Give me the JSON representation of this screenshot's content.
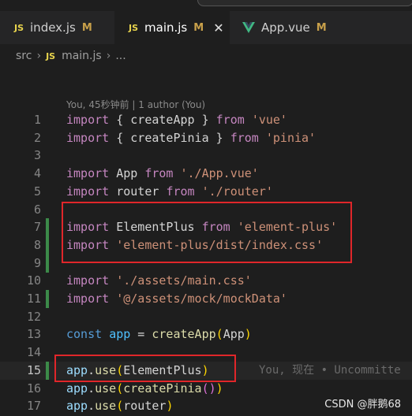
{
  "tabs": [
    {
      "label": "index.js",
      "icon": "js-icon",
      "status": "M",
      "active": false
    },
    {
      "label": "main.js",
      "icon": "js-icon",
      "status": "M",
      "active": true
    },
    {
      "label": "App.vue",
      "icon": "vue-icon",
      "status": "M",
      "active": false
    }
  ],
  "breadcrumb": {
    "folder": "src",
    "file": "main.js",
    "more": "..."
  },
  "blame_header": "You, 45秒钟前 | 1 author (You)",
  "inline_blame": "You, 现在 • Uncommitte",
  "watermark": "CSDN @胖鹅68",
  "lines": [
    {
      "n": "1",
      "tokens": [
        [
          "kw",
          "import"
        ],
        [
          "plain",
          " { createApp } "
        ],
        [
          "kw",
          "from"
        ],
        [
          "plain",
          " "
        ],
        [
          "str",
          "'vue'"
        ]
      ]
    },
    {
      "n": "2",
      "tokens": [
        [
          "kw",
          "import"
        ],
        [
          "plain",
          " { createPinia } "
        ],
        [
          "kw",
          "from"
        ],
        [
          "plain",
          " "
        ],
        [
          "str",
          "'pinia'"
        ]
      ]
    },
    {
      "n": "3",
      "tokens": []
    },
    {
      "n": "4",
      "tokens": [
        [
          "kw",
          "import"
        ],
        [
          "plain",
          " App "
        ],
        [
          "kw",
          "from"
        ],
        [
          "plain",
          " "
        ],
        [
          "str",
          "'./App.vue'"
        ]
      ]
    },
    {
      "n": "5",
      "tokens": [
        [
          "kw",
          "import"
        ],
        [
          "plain",
          " router "
        ],
        [
          "kw",
          "from"
        ],
        [
          "plain",
          " "
        ],
        [
          "str",
          "'./router'"
        ]
      ]
    },
    {
      "n": "6",
      "tokens": []
    },
    {
      "n": "7",
      "tokens": [
        [
          "kw",
          "import"
        ],
        [
          "plain",
          " ElementPlus "
        ],
        [
          "kw",
          "from"
        ],
        [
          "plain",
          " "
        ],
        [
          "str",
          "'element-plus'"
        ]
      ]
    },
    {
      "n": "8",
      "tokens": [
        [
          "kw",
          "import"
        ],
        [
          "plain",
          " "
        ],
        [
          "str",
          "'element-plus/dist/index.css'"
        ]
      ]
    },
    {
      "n": "9",
      "tokens": []
    },
    {
      "n": "10",
      "tokens": [
        [
          "kw",
          "import"
        ],
        [
          "plain",
          " "
        ],
        [
          "str",
          "'./assets/main.css'"
        ]
      ]
    },
    {
      "n": "11",
      "tokens": [
        [
          "kw",
          "import"
        ],
        [
          "plain",
          " "
        ],
        [
          "str",
          "'@/assets/mock/mockData'"
        ]
      ]
    },
    {
      "n": "12",
      "tokens": []
    },
    {
      "n": "13",
      "tokens": [
        [
          "blue",
          "const"
        ],
        [
          "plain",
          " "
        ],
        [
          "var",
          "app"
        ],
        [
          "plain",
          " = "
        ],
        [
          "fn",
          "createApp"
        ],
        [
          "brk",
          "("
        ],
        [
          "plain",
          "App"
        ],
        [
          "brk",
          ")"
        ]
      ]
    },
    {
      "n": "14",
      "tokens": []
    },
    {
      "n": "15",
      "tokens": [
        [
          "obj",
          "app"
        ],
        [
          "plain",
          "."
        ],
        [
          "fn",
          "use"
        ],
        [
          "brk",
          "("
        ],
        [
          "plain",
          "ElementPlus"
        ],
        [
          "brk",
          ")"
        ]
      ]
    },
    {
      "n": "16",
      "tokens": [
        [
          "obj",
          "app"
        ],
        [
          "plain",
          "."
        ],
        [
          "fn",
          "use"
        ],
        [
          "brk",
          "("
        ],
        [
          "fn",
          "createPinia"
        ],
        [
          "brk2",
          "()"
        ],
        [
          "brk",
          ")"
        ]
      ]
    },
    {
      "n": "17",
      "tokens": [
        [
          "obj",
          "app"
        ],
        [
          "plain",
          "."
        ],
        [
          "fn",
          "use"
        ],
        [
          "brk",
          "("
        ],
        [
          "plain",
          "router"
        ],
        [
          "brk",
          ")"
        ]
      ]
    }
  ],
  "colors": {
    "keyword": "#c586c0",
    "string": "#ce9178",
    "function": "#dcdcaa",
    "gutter_added": "#3c8a49",
    "highlight_box": "#e0262a"
  }
}
